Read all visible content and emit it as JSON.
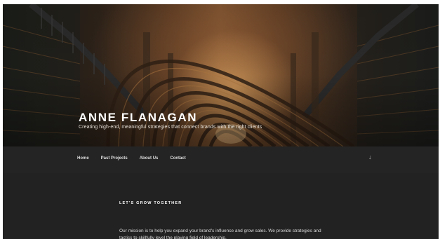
{
  "site": {
    "title": "ANNE FLANAGAN",
    "tagline": "Creating high-end, meaningful strategies that connect brands with the right clients"
  },
  "nav": {
    "items": [
      {
        "label": "Home"
      },
      {
        "label": "Past Projects"
      },
      {
        "label": "About Us"
      },
      {
        "label": "Contact"
      }
    ],
    "scroll_icon": "arrow-down-icon",
    "scroll_glyph": "↓"
  },
  "content": {
    "heading": "LET'S GROW TOGETHER",
    "paragraph": "Our mission is to help you expand your brand's influence and grow sales. We provide strategies and tactics to skillfully level the playing field of leadership."
  },
  "colors": {
    "nav_bg": "#242424",
    "content_bg": "#222222",
    "title_text": "#ffffff"
  }
}
